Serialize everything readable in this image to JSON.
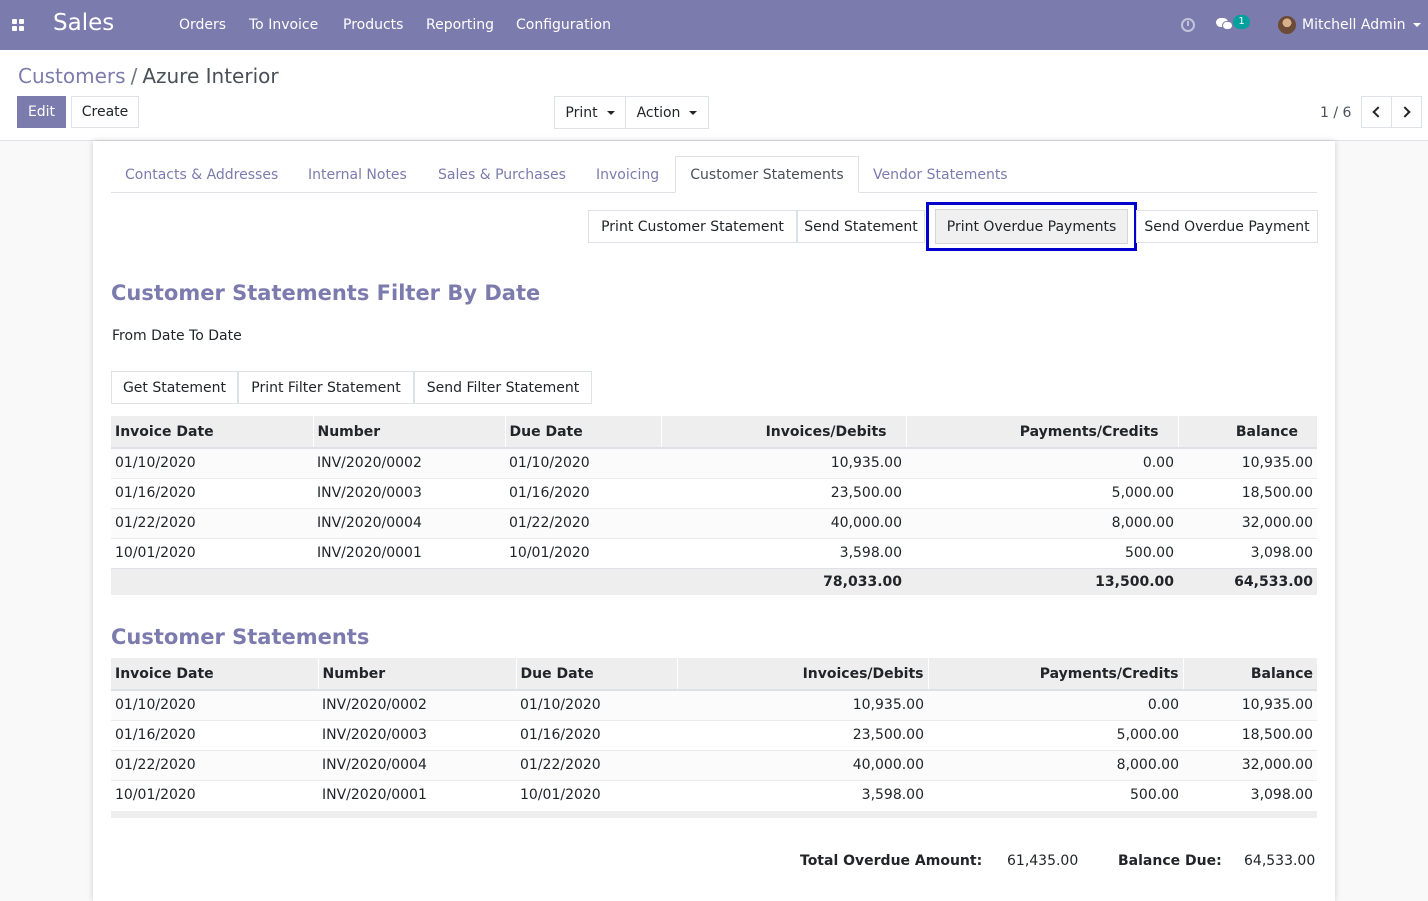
{
  "navbar": {
    "app_title": "Sales",
    "menu": [
      "Orders",
      "To Invoice",
      "Products",
      "Reporting",
      "Configuration"
    ],
    "chat_count": "1",
    "user": "Mitchell Admin"
  },
  "breadcrumb": {
    "parent": "Customers",
    "separator": "/",
    "current": "Azure Interior"
  },
  "buttons": {
    "edit": "Edit",
    "create": "Create",
    "print": "Print",
    "action": "Action"
  },
  "pager": {
    "value": "1 / 6"
  },
  "tabs": [
    "Contacts & Addresses",
    "Internal Notes",
    "Sales & Purchases",
    "Invoicing",
    "Customer Statements",
    "Vendor Statements"
  ],
  "statement_buttons": [
    "Print Customer Statement",
    "Send Statement",
    "Print Overdue Payments",
    "Send Overdue Payment"
  ],
  "filter_section": {
    "title": "Customer Statements Filter By Date",
    "date_label": "From Date To Date",
    "buttons": [
      "Get Statement",
      "Print Filter Statement",
      "Send Filter Statement"
    ],
    "columns": [
      "Invoice Date",
      "Number",
      "Due Date",
      "Invoices/Debits",
      "Payments/Credits",
      "Balance"
    ],
    "rows": [
      [
        "01/10/2020",
        "INV/2020/0002",
        "01/10/2020",
        "10,935.00",
        "0.00",
        "10,935.00"
      ],
      [
        "01/16/2020",
        "INV/2020/0003",
        "01/16/2020",
        "23,500.00",
        "5,000.00",
        "18,500.00"
      ],
      [
        "01/22/2020",
        "INV/2020/0004",
        "01/22/2020",
        "40,000.00",
        "8,000.00",
        "32,000.00"
      ],
      [
        "10/01/2020",
        "INV/2020/0001",
        "10/01/2020",
        "3,598.00",
        "500.00",
        "3,098.00"
      ]
    ],
    "totals": [
      "78,033.00",
      "13,500.00",
      "64,533.00"
    ]
  },
  "statements_section": {
    "title": "Customer Statements",
    "columns": [
      "Invoice Date",
      "Number",
      "Due Date",
      "Invoices/Debits",
      "Payments/Credits",
      "Balance"
    ],
    "rows": [
      [
        "01/10/2020",
        "INV/2020/0002",
        "01/10/2020",
        "10,935.00",
        "0.00",
        "10,935.00"
      ],
      [
        "01/16/2020",
        "INV/2020/0003",
        "01/16/2020",
        "23,500.00",
        "5,000.00",
        "18,500.00"
      ],
      [
        "01/22/2020",
        "INV/2020/0004",
        "01/22/2020",
        "40,000.00",
        "8,000.00",
        "32,000.00"
      ],
      [
        "10/01/2020",
        "INV/2020/0001",
        "10/01/2020",
        "3,598.00",
        "500.00",
        "3,098.00"
      ]
    ]
  },
  "summary": {
    "overdue_label": "Total Overdue Amount:",
    "overdue_value": "61,435.00",
    "balance_label": "Balance Due:",
    "balance_value": "64,533.00"
  },
  "colors": {
    "brand": "#7c7bad",
    "highlight": "#0000cc",
    "badge": "#00a09d"
  }
}
